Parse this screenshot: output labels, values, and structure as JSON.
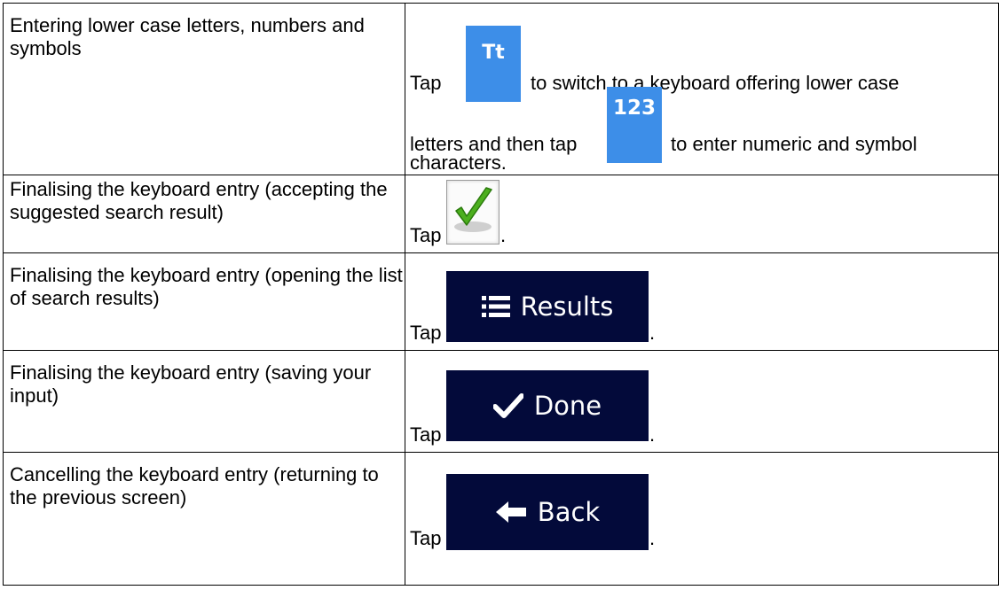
{
  "rows": [
    {
      "task": "Entering lower case letters, numbers and symbols",
      "action": {
        "tap": "Tap",
        "text1": "to switch to a keyboard offering lower case",
        "text2": "letters and then tap",
        "text3": "to enter numeric and symbol",
        "text4": "characters.",
        "key1_label": "Tt",
        "key2_label": "123"
      }
    },
    {
      "task": "Finalising the keyboard entry (accepting the suggested search result)",
      "action": {
        "tap": "Tap",
        "end": ".",
        "icon": "checkmark-icon"
      }
    },
    {
      "task": "Finalising the keyboard entry (opening the list of search results)",
      "action": {
        "tap": "Tap",
        "end": ".",
        "button_label": "Results",
        "icon": "list-icon"
      }
    },
    {
      "task": "Finalising the keyboard entry (saving your input)",
      "action": {
        "tap": "Tap",
        "end": ".",
        "button_label": "Done",
        "icon": "check-icon"
      }
    },
    {
      "task": "Cancelling the keyboard entry (returning to the previous screen)",
      "action": {
        "tap": "Tap",
        "end": ".",
        "button_label": "Back",
        "icon": "arrow-left-icon"
      }
    }
  ],
  "colors": {
    "key_blue": "#3d8ee8",
    "button_navy": "#030a3a",
    "check_green": "#4caf1e"
  }
}
